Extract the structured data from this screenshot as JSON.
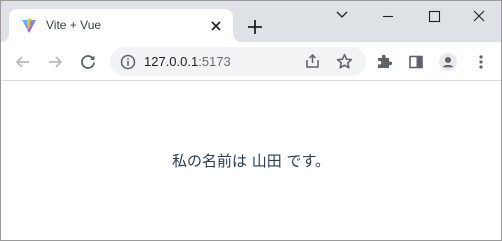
{
  "tab": {
    "title": "Vite + Vue"
  },
  "address_bar": {
    "host": "127.0.0.1",
    "port": ":5173"
  },
  "page": {
    "message": "私の名前は 山田 です。"
  },
  "icons": {
    "favicon": "vite-logo-icon",
    "tab_close": "close-icon",
    "new_tab": "plus-icon",
    "tab_search": "chevron-down-icon",
    "minimize": "minimize-icon",
    "maximize": "maximize-icon",
    "window_close": "close-icon",
    "back": "arrow-left-icon",
    "forward": "arrow-right-icon",
    "reload": "reload-icon",
    "site_info": "info-icon",
    "share": "share-icon",
    "bookmark": "star-icon",
    "extensions": "puzzle-icon",
    "side_panel": "side-panel-icon",
    "profile": "profile-icon",
    "menu": "kebab-menu-icon"
  },
  "colors": {
    "tabstrip": "#dee1e6",
    "omnibox": "#f1f3f4",
    "page_text": "#2c3e50",
    "vite_purple": "#a754fc",
    "vite_yellow": "#ffc517"
  }
}
